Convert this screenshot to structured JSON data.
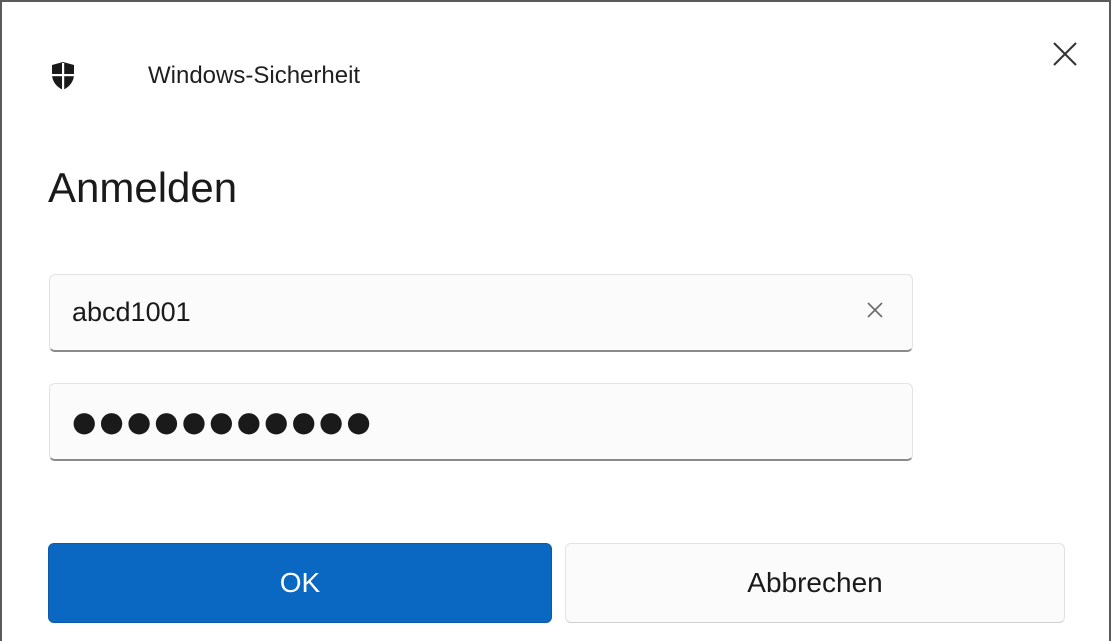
{
  "window": {
    "title": "Windows-Sicherheit",
    "icon": "shield-icon",
    "close_icon": "close-icon"
  },
  "dialog": {
    "heading": "Anmelden"
  },
  "username_field": {
    "value": "abcd1001",
    "clear_icon": "clear-icon"
  },
  "password_field": {
    "masked_value": "●●●●●●●●●●●"
  },
  "buttons": {
    "ok_label": "OK",
    "cancel_label": "Abbrechen"
  },
  "colors": {
    "accent": "#0a67c2",
    "text": "#1a1a1a",
    "field_background": "#fbfbfb"
  }
}
